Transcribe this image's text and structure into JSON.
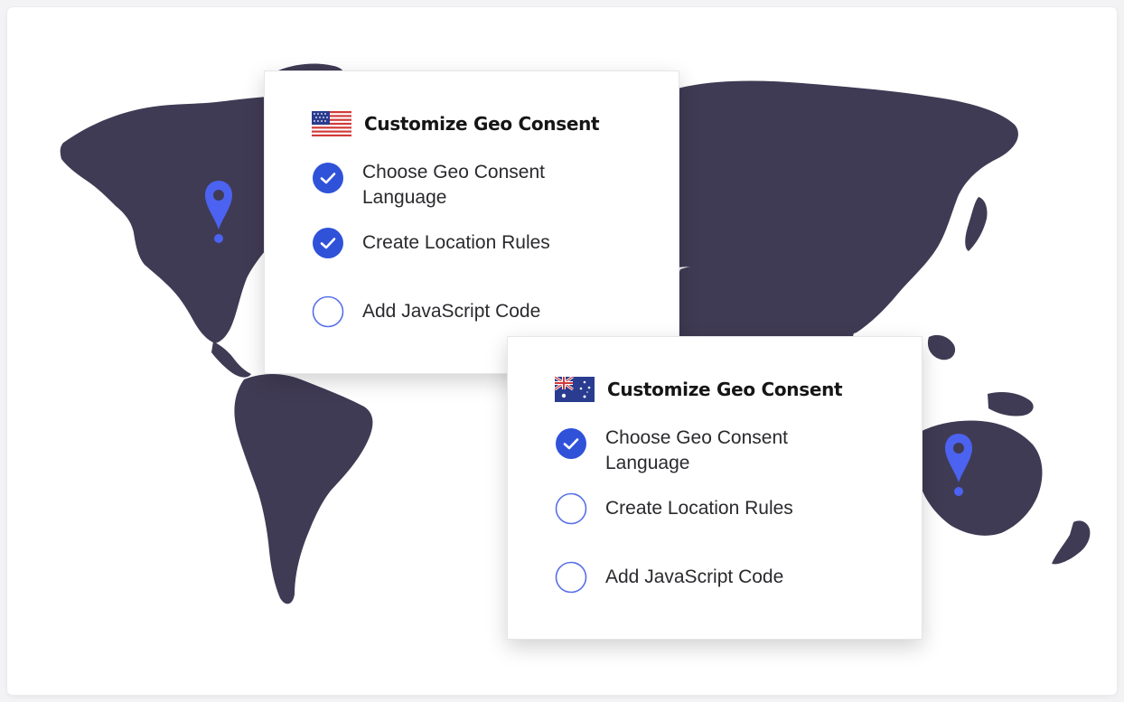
{
  "colors": {
    "map_land": "#403b54",
    "pin": "#4b63f0",
    "check_fill": "#2f52d9",
    "outline": "#5870e8",
    "flag_red": "#d23a3a",
    "flag_blue": "#2a3c8f"
  },
  "icons": {
    "done": "check-circle-icon",
    "todo": "empty-circle-icon",
    "location": "map-pin-icon"
  },
  "cards": [
    {
      "flag": "us-flag-icon",
      "title": "Customize Geo Consent",
      "steps": [
        {
          "label": "Choose Geo Consent Language",
          "done": true
        },
        {
          "label": "Create Location Rules",
          "done": true
        },
        {
          "label": "Add JavaScript Code",
          "done": false
        }
      ]
    },
    {
      "flag": "australia-flag-icon",
      "title": "Customize Geo Consent",
      "steps": [
        {
          "label": "Choose Geo Consent Language",
          "done": true
        },
        {
          "label": "Create Location Rules",
          "done": false
        },
        {
          "label": "Add JavaScript Code",
          "done": false
        }
      ]
    }
  ]
}
